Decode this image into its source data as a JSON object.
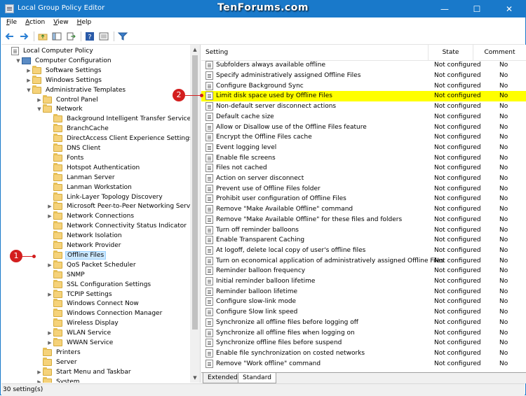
{
  "window": {
    "title": "Local Group Policy Editor",
    "watermark": "TenForums.com",
    "minimize": "—",
    "maximize": "☐",
    "close": "✕"
  },
  "menu": [
    {
      "label": "File",
      "key": "F",
      "rest": "ile"
    },
    {
      "label": "Action",
      "key": "A",
      "rest": "ction"
    },
    {
      "label": "View",
      "key": "V",
      "rest": "iew"
    },
    {
      "label": "Help",
      "key": "H",
      "rest": "elp"
    }
  ],
  "tree": [
    {
      "label": "Local Computer Policy",
      "indent": 0,
      "icon": "policy",
      "expander": ""
    },
    {
      "label": "Computer Configuration",
      "indent": 1,
      "icon": "computer",
      "expander": "▼"
    },
    {
      "label": "Software Settings",
      "indent": 2,
      "icon": "folder",
      "expander": "▶"
    },
    {
      "label": "Windows Settings",
      "indent": 2,
      "icon": "folder",
      "expander": "▶"
    },
    {
      "label": "Administrative Templates",
      "indent": 2,
      "icon": "folder",
      "expander": "▼"
    },
    {
      "label": "Control Panel",
      "indent": 3,
      "icon": "folder",
      "expander": "▶"
    },
    {
      "label": "Network",
      "indent": 3,
      "icon": "folder",
      "expander": "▼"
    },
    {
      "label": "Background Intelligent Transfer Service (BITS)",
      "indent": 4,
      "icon": "folder",
      "expander": ""
    },
    {
      "label": "BranchCache",
      "indent": 4,
      "icon": "folder",
      "expander": ""
    },
    {
      "label": "DirectAccess Client Experience Settings",
      "indent": 4,
      "icon": "folder",
      "expander": ""
    },
    {
      "label": "DNS Client",
      "indent": 4,
      "icon": "folder",
      "expander": ""
    },
    {
      "label": "Fonts",
      "indent": 4,
      "icon": "folder",
      "expander": ""
    },
    {
      "label": "Hotspot Authentication",
      "indent": 4,
      "icon": "folder",
      "expander": ""
    },
    {
      "label": "Lanman Server",
      "indent": 4,
      "icon": "folder",
      "expander": ""
    },
    {
      "label": "Lanman Workstation",
      "indent": 4,
      "icon": "folder",
      "expander": ""
    },
    {
      "label": "Link-Layer Topology Discovery",
      "indent": 4,
      "icon": "folder",
      "expander": ""
    },
    {
      "label": "Microsoft Peer-to-Peer Networking Services",
      "indent": 4,
      "icon": "folder",
      "expander": "▶"
    },
    {
      "label": "Network Connections",
      "indent": 4,
      "icon": "folder",
      "expander": "▶"
    },
    {
      "label": "Network Connectivity Status Indicator",
      "indent": 4,
      "icon": "folder",
      "expander": ""
    },
    {
      "label": "Network Isolation",
      "indent": 4,
      "icon": "folder",
      "expander": ""
    },
    {
      "label": "Network Provider",
      "indent": 4,
      "icon": "folder",
      "expander": ""
    },
    {
      "label": "Offline Files",
      "indent": 4,
      "icon": "folder",
      "expander": "",
      "selected": true
    },
    {
      "label": "QoS Packet Scheduler",
      "indent": 4,
      "icon": "folder",
      "expander": "▶"
    },
    {
      "label": "SNMP",
      "indent": 4,
      "icon": "folder",
      "expander": ""
    },
    {
      "label": "SSL Configuration Settings",
      "indent": 4,
      "icon": "folder",
      "expander": ""
    },
    {
      "label": "TCPIP Settings",
      "indent": 4,
      "icon": "folder",
      "expander": "▶"
    },
    {
      "label": "Windows Connect Now",
      "indent": 4,
      "icon": "folder",
      "expander": ""
    },
    {
      "label": "Windows Connection Manager",
      "indent": 4,
      "icon": "folder",
      "expander": ""
    },
    {
      "label": "Wireless Display",
      "indent": 4,
      "icon": "folder",
      "expander": ""
    },
    {
      "label": "WLAN Service",
      "indent": 4,
      "icon": "folder",
      "expander": "▶"
    },
    {
      "label": "WWAN Service",
      "indent": 4,
      "icon": "folder",
      "expander": "▶"
    },
    {
      "label": "Printers",
      "indent": 3,
      "icon": "folder",
      "expander": ""
    },
    {
      "label": "Server",
      "indent": 3,
      "icon": "folder",
      "expander": ""
    },
    {
      "label": "Start Menu and Taskbar",
      "indent": 3,
      "icon": "folder",
      "expander": "▶"
    },
    {
      "label": "System",
      "indent": 3,
      "icon": "folder",
      "expander": "▶"
    }
  ],
  "list": {
    "columns": {
      "setting": "Setting",
      "state": "State",
      "comment": "Comment"
    },
    "rows": [
      {
        "setting": "Subfolders always available offline",
        "state": "Not configured",
        "comment": "No"
      },
      {
        "setting": "Specify administratively assigned Offline Files",
        "state": "Not configured",
        "comment": "No"
      },
      {
        "setting": "Configure Background Sync",
        "state": "Not configured",
        "comment": "No"
      },
      {
        "setting": "Limit disk space used by Offline Files",
        "state": "Not configured",
        "comment": "No",
        "highlight": true
      },
      {
        "setting": "Non-default server disconnect actions",
        "state": "Not configured",
        "comment": "No"
      },
      {
        "setting": "Default cache size",
        "state": "Not configured",
        "comment": "No"
      },
      {
        "setting": "Allow or Disallow use of the Offline Files feature",
        "state": "Not configured",
        "comment": "No"
      },
      {
        "setting": "Encrypt the Offline Files cache",
        "state": "Not configured",
        "comment": "No"
      },
      {
        "setting": "Event logging level",
        "state": "Not configured",
        "comment": "No"
      },
      {
        "setting": "Enable file screens",
        "state": "Not configured",
        "comment": "No"
      },
      {
        "setting": "Files not cached",
        "state": "Not configured",
        "comment": "No"
      },
      {
        "setting": "Action on server disconnect",
        "state": "Not configured",
        "comment": "No"
      },
      {
        "setting": "Prevent use of Offline Files folder",
        "state": "Not configured",
        "comment": "No"
      },
      {
        "setting": "Prohibit user configuration of Offline Files",
        "state": "Not configured",
        "comment": "No"
      },
      {
        "setting": "Remove \"Make Available Offline\" command",
        "state": "Not configured",
        "comment": "No"
      },
      {
        "setting": "Remove \"Make Available Offline\" for these files and folders",
        "state": "Not configured",
        "comment": "No"
      },
      {
        "setting": "Turn off reminder balloons",
        "state": "Not configured",
        "comment": "No"
      },
      {
        "setting": "Enable Transparent Caching",
        "state": "Not configured",
        "comment": "No"
      },
      {
        "setting": "At logoff, delete local copy of user's offline files",
        "state": "Not configured",
        "comment": "No"
      },
      {
        "setting": "Turn on economical application of administratively assigned Offline Files",
        "state": "Not configured",
        "comment": "No"
      },
      {
        "setting": "Reminder balloon frequency",
        "state": "Not configured",
        "comment": "No"
      },
      {
        "setting": "Initial reminder balloon lifetime",
        "state": "Not configured",
        "comment": "No"
      },
      {
        "setting": "Reminder balloon lifetime",
        "state": "Not configured",
        "comment": "No"
      },
      {
        "setting": "Configure slow-link mode",
        "state": "Not configured",
        "comment": "No"
      },
      {
        "setting": "Configure Slow link speed",
        "state": "Not configured",
        "comment": "No"
      },
      {
        "setting": "Synchronize all offline files before logging off",
        "state": "Not configured",
        "comment": "No"
      },
      {
        "setting": "Synchronize all offline files when logging on",
        "state": "Not configured",
        "comment": "No"
      },
      {
        "setting": "Synchronize offline files before suspend",
        "state": "Not configured",
        "comment": "No"
      },
      {
        "setting": "Enable file synchronization on costed networks",
        "state": "Not configured",
        "comment": "No"
      },
      {
        "setting": "Remove \"Work offline\" command",
        "state": "Not configured",
        "comment": "No"
      }
    ]
  },
  "tabs": {
    "extended": "Extended",
    "standard": "Standard"
  },
  "status": {
    "text": "30 setting(s)"
  },
  "callouts": {
    "one": "1",
    "two": "2"
  },
  "colors": {
    "titlebar": "#1979ca",
    "highlight": "#ffff00",
    "callout": "#d31e1e"
  }
}
